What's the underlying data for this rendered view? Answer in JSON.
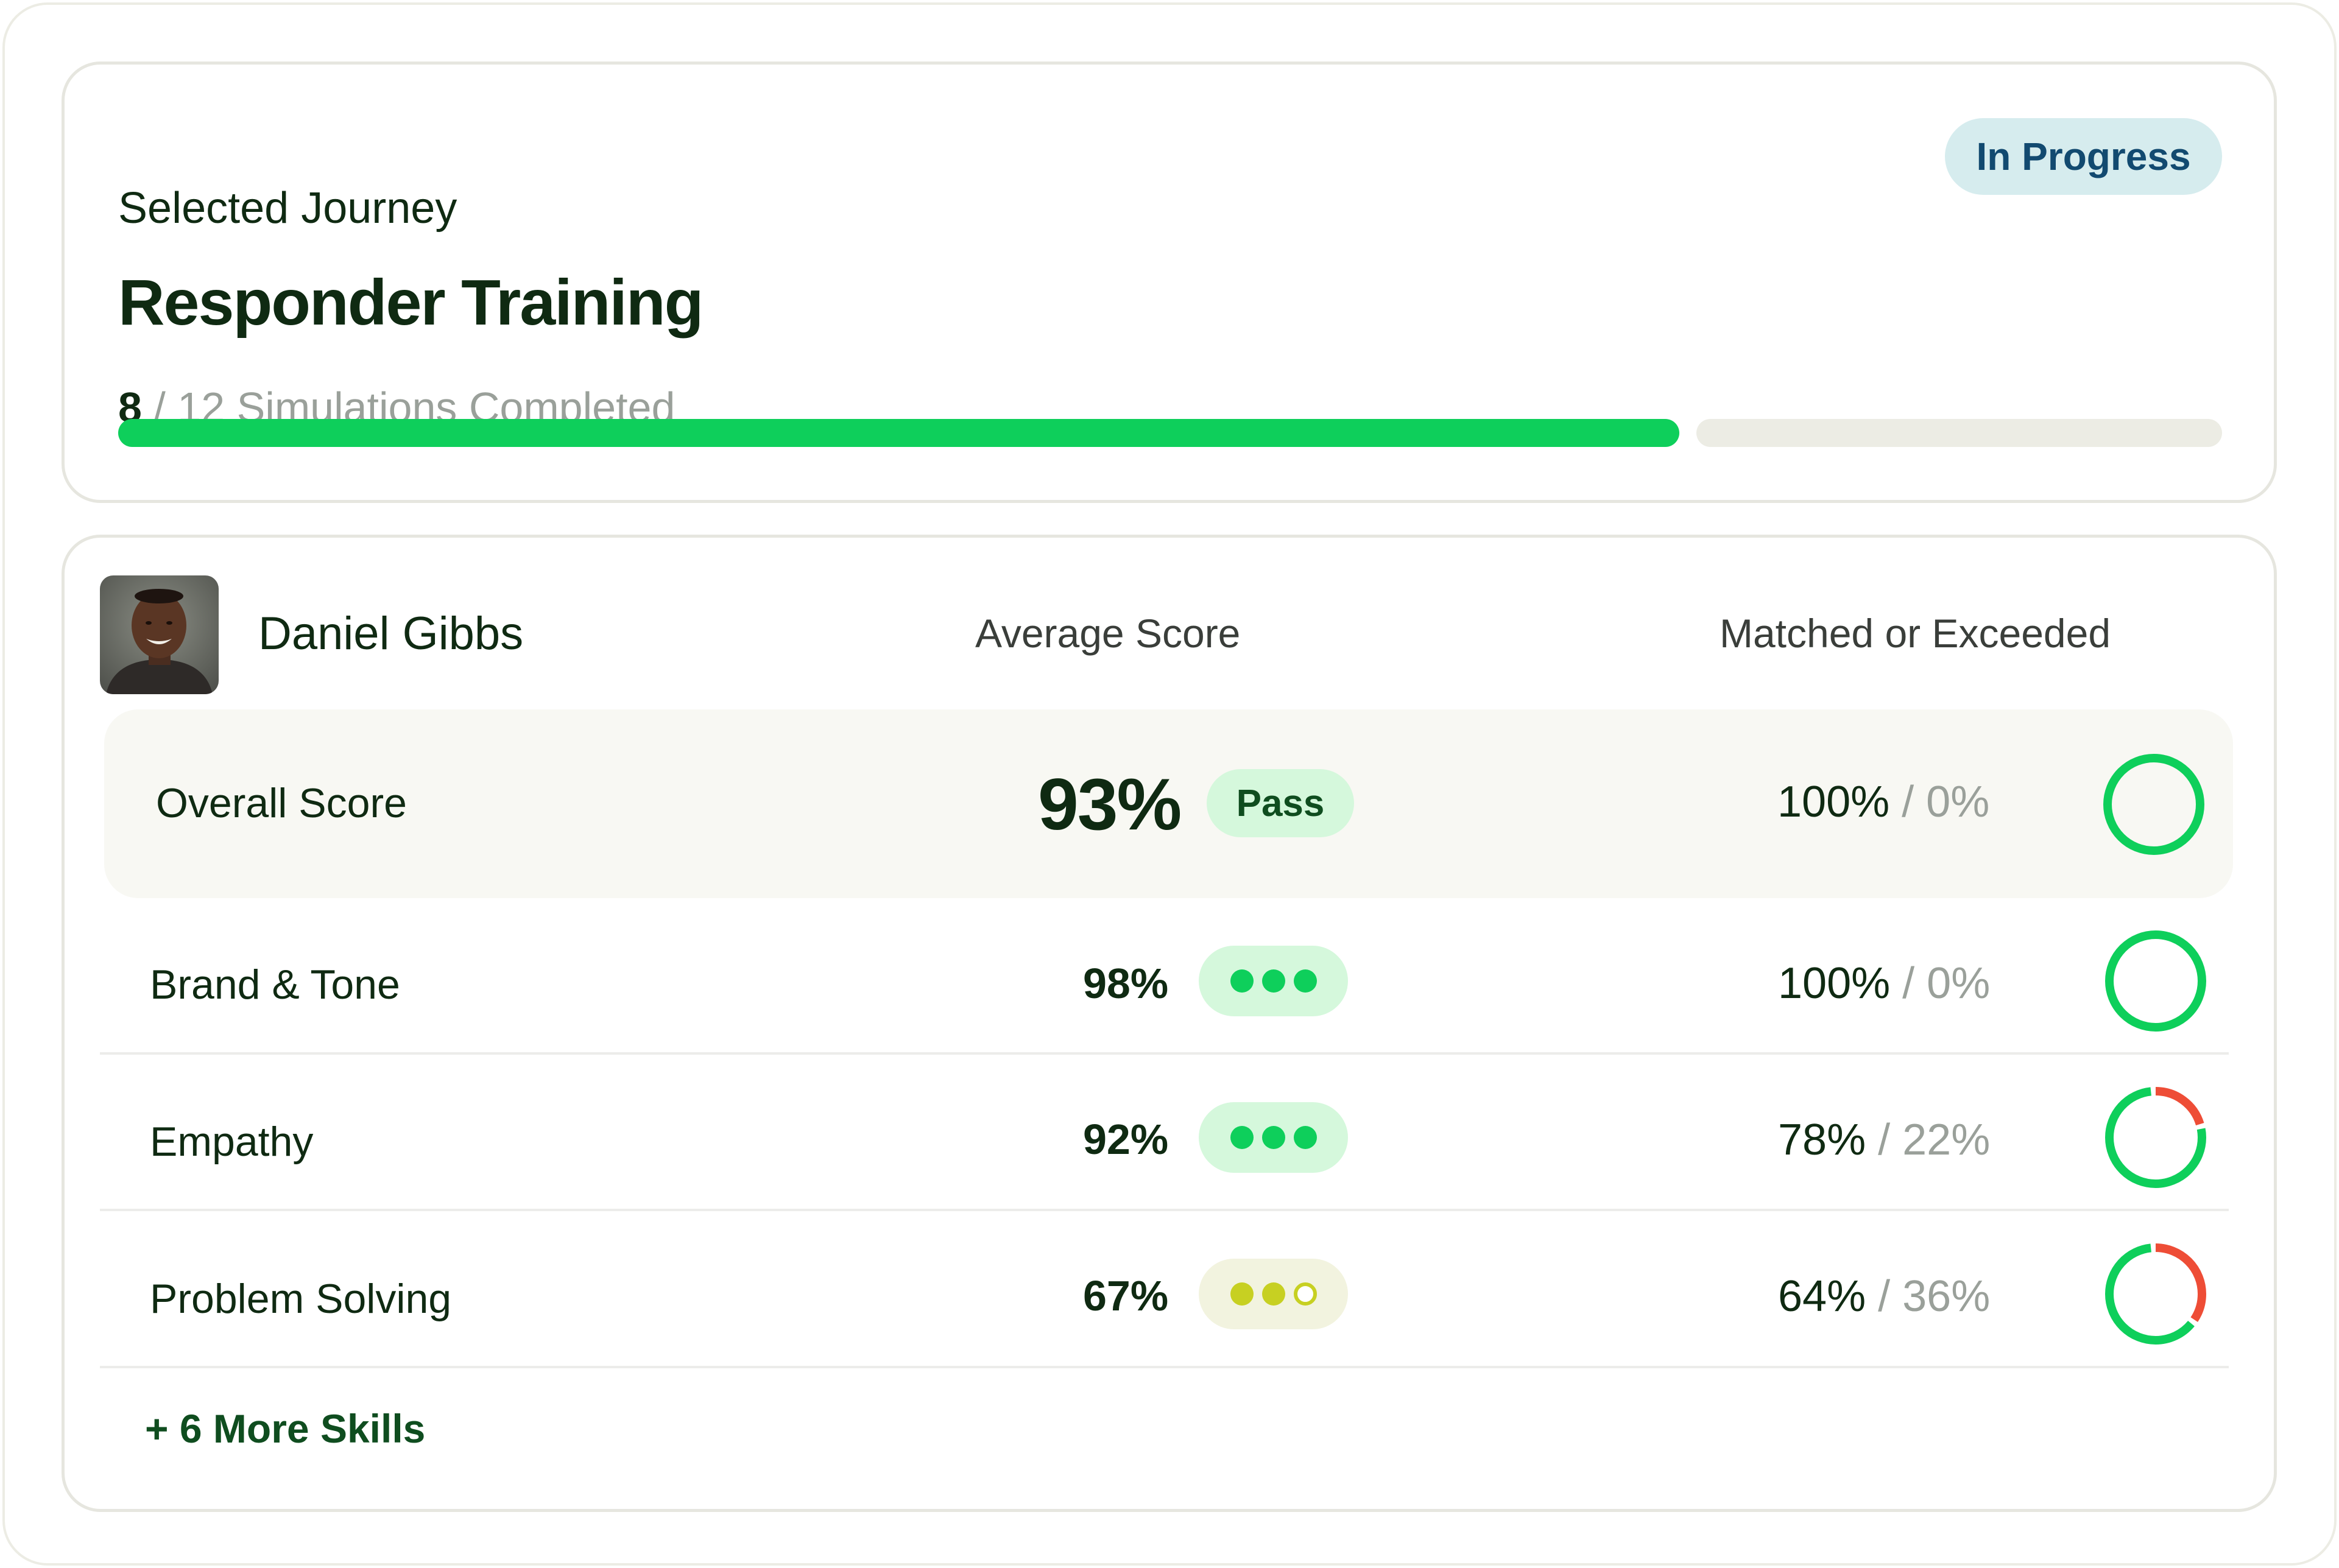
{
  "journey": {
    "eyebrow": "Selected Journey",
    "title": "Responder Training",
    "status": "In Progress",
    "completed": "8",
    "of_total": "/ 12 Simulations Completed",
    "progress": 0.742
  },
  "learner": {
    "name": "Daniel Gibbs",
    "avatar_icon": "person-portrait"
  },
  "columns": {
    "average_score": "Average Score",
    "matched": "Matched or Exceeded"
  },
  "overall": {
    "label": "Overall Score",
    "score": "93%",
    "badge": "Pass",
    "matched": "100%",
    "missed": "/ 0%",
    "matched_fraction": 1.0
  },
  "skills": [
    {
      "label": "Brand & Tone",
      "score": "98%",
      "level": 3,
      "matched": "100%",
      "missed": "/ 0%",
      "matched_fraction": 1.0
    },
    {
      "label": "Empathy",
      "score": "92%",
      "level": 3,
      "matched": "78%",
      "missed": "/ 22%",
      "matched_fraction": 0.78
    },
    {
      "label": "Problem Solving",
      "score": "67%",
      "level": 2,
      "matched": "64%",
      "missed": "/ 36%",
      "matched_fraction": 0.64
    }
  ],
  "more_link": "+ 6 More Skills",
  "colors": {
    "green": "#0ecf5b",
    "red": "#ee4d36",
    "olive": "#c7d022",
    "pass_bg": "#d5f8dc",
    "badge_bg": "#d6ecee"
  }
}
